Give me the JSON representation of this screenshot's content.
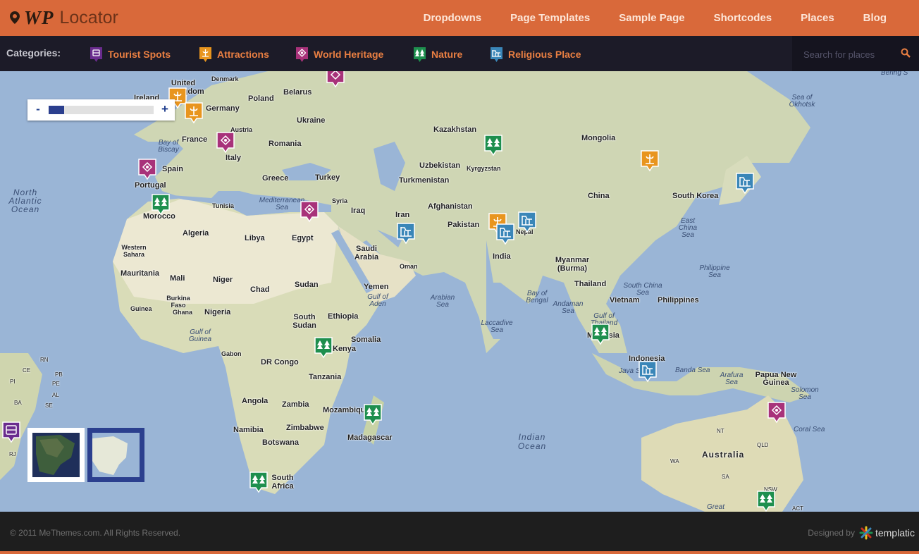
{
  "header": {
    "logo_wp": "WP",
    "logo_locator": "Locator",
    "nav": [
      "Dropdowns",
      "Page Templates",
      "Sample Page",
      "Shortcodes",
      "Places",
      "Blog"
    ]
  },
  "categories": {
    "label": "Categories:",
    "items": [
      {
        "label": "Tourist Spots",
        "icon": "bus-icon",
        "color": "#6a2c8e"
      },
      {
        "label": "Attractions",
        "icon": "fountain-icon",
        "color": "#e8951e"
      },
      {
        "label": "World Heritage",
        "icon": "heritage-icon",
        "color": "#a8327a"
      },
      {
        "label": "Nature",
        "icon": "trees-icon",
        "color": "#1e8f4e"
      },
      {
        "label": "Religious Place",
        "icon": "temple-icon",
        "color": "#3a86b8"
      }
    ]
  },
  "search": {
    "placeholder": "Search for places"
  },
  "map": {
    "zoom": {
      "minus": "-",
      "plus": "+",
      "level": 0.15
    },
    "labels": {
      "ocean": [
        "North Atlantic Ocean",
        "Indian Ocean"
      ],
      "countries": [
        "United Kingdom",
        "Ireland",
        "Denmark",
        "Poland",
        "Belarus",
        "Germany",
        "Ukraine",
        "Austria",
        "France",
        "Romania",
        "Spain",
        "Portugal",
        "Italy",
        "Greece",
        "Turkey",
        "Kazakhstan",
        "Mongolia",
        "Uzbekistan",
        "Kyrgyzstan",
        "Turkmenistan",
        "China",
        "South Korea",
        "Iran",
        "Iraq",
        "Syria",
        "Afghanistan",
        "Pakistan",
        "Nepal",
        "India",
        "Morocco",
        "Tunisia",
        "Algeria",
        "Libya",
        "Egypt",
        "Western Sahara",
        "Saudi Arabia",
        "Oman",
        "Mauritania",
        "Mali",
        "Niger",
        "Chad",
        "Sudan",
        "Yemen",
        "Burkina Faso",
        "Ghana",
        "Guinea",
        "Nigeria",
        "South Sudan",
        "Ethiopia",
        "Somalia",
        "Gabon",
        "DR Congo",
        "Kenya",
        "Tanzania",
        "Angola",
        "Zambia",
        "Mozambique",
        "Madagascar",
        "Namibia",
        "Zimbabwe",
        "Botswana",
        "South Africa",
        "Myanmar (Burma)",
        "Thailand",
        "Vietnam",
        "Philippines",
        "Malaysia",
        "Indonesia",
        "Papua New Guinea",
        "Australia"
      ],
      "seas": [
        "Sea of Okhotsk",
        "Bering S",
        "Bay of Biscay",
        "Mediterranean Sea",
        "East China Sea",
        "Philippine Sea",
        "South China Sea",
        "Bay of Bengal",
        "Andaman Sea",
        "Gulf of Thailand",
        "Arabian Sea",
        "Gulf of Aden",
        "Laccadive Sea",
        "Gulf of Guinea",
        "Java Sea",
        "Banda Sea",
        "Arafura Sea",
        "Solomon Sea",
        "Coral Sea",
        "Great"
      ],
      "states": [
        "NT",
        "QLD",
        "WA",
        "SA",
        "NSW",
        "ACT",
        "RN",
        "CE",
        "PB",
        "PE",
        "AL",
        "SE",
        "PI",
        "BA",
        "RJ"
      ]
    },
    "thumbs": [
      {
        "name": "satellite",
        "selected": false
      },
      {
        "name": "map",
        "selected": true
      }
    ]
  },
  "footer": {
    "copyright": "© 2011 MeThemes.com. All Rights Reserved.",
    "designed_by": "Designed by",
    "brand": "templatic"
  }
}
